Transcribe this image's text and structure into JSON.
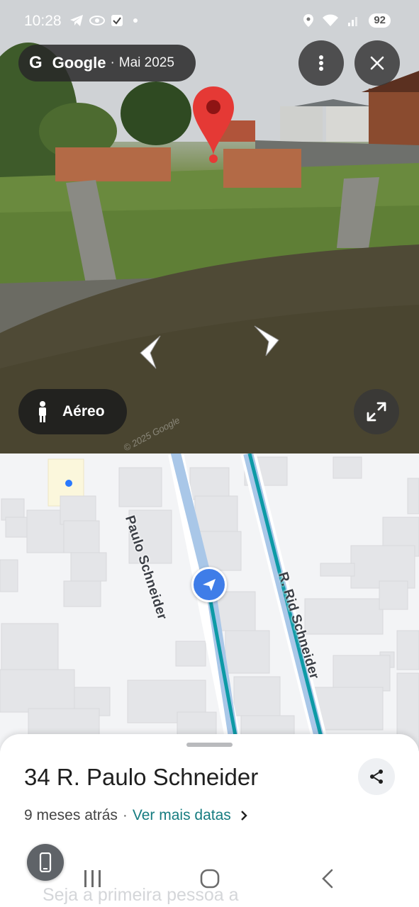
{
  "status_bar": {
    "time": "10:28",
    "battery": "92",
    "left_icons": [
      "telegram-icon",
      "app-icon",
      "checkbox-icon",
      "dot-icon"
    ],
    "right_icons": [
      "location-icon",
      "wifi-icon",
      "signal-icon"
    ]
  },
  "street_view": {
    "brand": "Google",
    "separator": "·",
    "date": "Mai 2025",
    "aerial_label": "Aéreo",
    "watermark": "© 2025 Google",
    "buttons": [
      "more-options-icon",
      "close-icon",
      "expand-icon",
      "nav-arrow-left",
      "nav-arrow-right"
    ],
    "pin_color": "#e53935"
  },
  "map": {
    "streets": [
      {
        "label": "R. Paulo Schneider",
        "visible_text": "Paulo Schneider"
      },
      {
        "label": "R. Rid Schneider"
      }
    ],
    "route_color": "#0d9aa6"
  },
  "sheet": {
    "address": "34 R. Paulo Schneider",
    "age": "9 meses atrás",
    "separator": "·",
    "more_dates_link": "Ver mais datas",
    "faded_text": "Seja a primeira pessoa a",
    "link_color": "#167c80"
  },
  "system_nav": [
    "recent-apps",
    "home",
    "back"
  ]
}
